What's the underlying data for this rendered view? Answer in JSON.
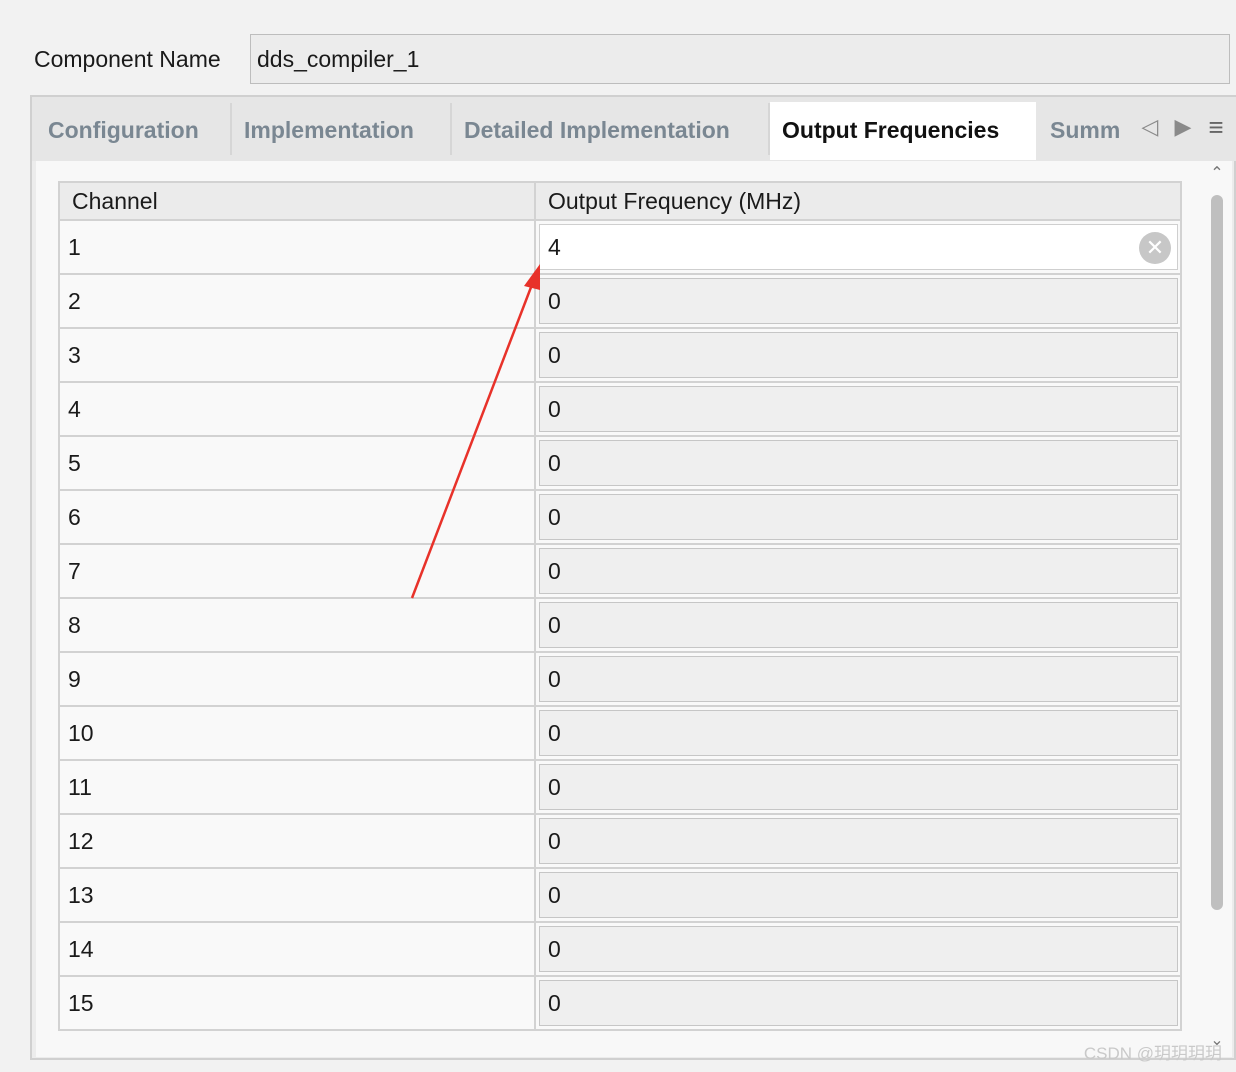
{
  "component": {
    "label": "Component Name",
    "value": "dds_compiler_1"
  },
  "tabs": [
    {
      "label": "Configuration",
      "active": false
    },
    {
      "label": "Implementation",
      "active": false
    },
    {
      "label": "Detailed Implementation",
      "active": false
    },
    {
      "label": "Output Frequencies",
      "active": true
    },
    {
      "label": "Summ",
      "active": false
    }
  ],
  "table": {
    "columns": [
      "Channel",
      "Output Frequency (MHz)"
    ],
    "rows": [
      {
        "channel": "1",
        "value": "4"
      },
      {
        "channel": "2",
        "value": "0"
      },
      {
        "channel": "3",
        "value": "0"
      },
      {
        "channel": "4",
        "value": "0"
      },
      {
        "channel": "5",
        "value": "0"
      },
      {
        "channel": "6",
        "value": "0"
      },
      {
        "channel": "7",
        "value": "0"
      },
      {
        "channel": "8",
        "value": "0"
      },
      {
        "channel": "9",
        "value": "0"
      },
      {
        "channel": "10",
        "value": "0"
      },
      {
        "channel": "11",
        "value": "0"
      },
      {
        "channel": "12",
        "value": "0"
      },
      {
        "channel": "13",
        "value": "0"
      },
      {
        "channel": "14",
        "value": "0"
      },
      {
        "channel": "15",
        "value": "0"
      }
    ]
  },
  "icons": {
    "prev": "tab-scroll-left-icon",
    "next": "tab-scroll-right-icon",
    "menu": "tab-menu-icon",
    "clear": "clear-field-icon"
  },
  "watermark": "CSDN @玥玥玥玥",
  "annotation_color": "#e8322a"
}
